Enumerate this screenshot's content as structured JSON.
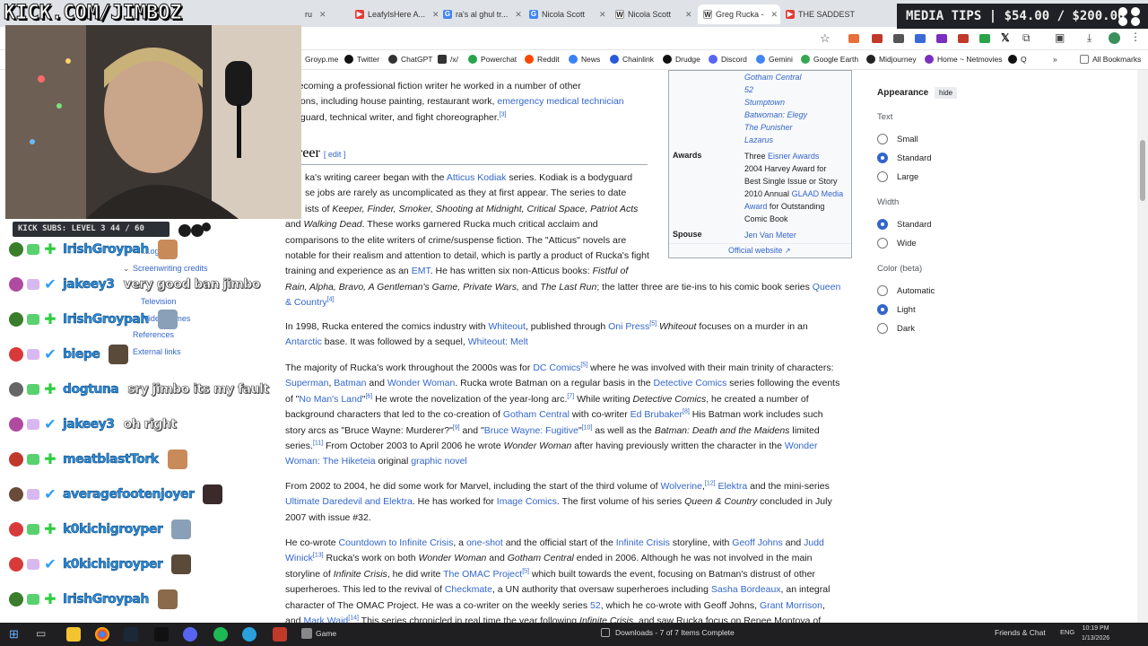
{
  "overlay": {
    "channel": "KICK.COM/JIMBOZ",
    "media_tips": "MEDIA TIPS | $54.00 / $200.00",
    "kick_subs": "KICK SUBS: LEVEL 3  44 / 60"
  },
  "tabs": [
    {
      "label": "ru",
      "color": "#e5a32b"
    },
    {
      "label": "LeafyIsHere A...",
      "color": "#e53935"
    },
    {
      "label": "ra's al ghul tr...",
      "color": "#4285f4"
    },
    {
      "label": "Nicola Scott",
      "color": "#4285f4"
    },
    {
      "label": "Nicola Scott",
      "color": "#222222"
    },
    {
      "label": "Greg Rucka -",
      "color": "#222222"
    },
    {
      "label": "THE SADDEST",
      "color": "#e53935"
    }
  ],
  "bookmarks": [
    {
      "label": "Groyp.me",
      "color": "#c0392b"
    },
    {
      "label": "Twitter",
      "color": "#111111"
    },
    {
      "label": "ChatGPT",
      "color": "#333333"
    },
    {
      "label": "/x/",
      "color": "#333333"
    },
    {
      "label": "Powerchat",
      "color": "#2aa34a"
    },
    {
      "label": "Reddit",
      "color": "#ff4500"
    },
    {
      "label": "News",
      "color": "#3b82f6"
    },
    {
      "label": "Chainlink",
      "color": "#2a5ada"
    },
    {
      "label": "Drudge",
      "color": "#111111"
    },
    {
      "label": "Discord",
      "color": "#5865f2"
    },
    {
      "label": "Gemini",
      "color": "#4285f4"
    },
    {
      "label": "Google Earth",
      "color": "#34a853"
    },
    {
      "label": "Midjourney",
      "color": "#222222"
    },
    {
      "label": "Home ~ Netmovies",
      "color": "#7b2fbe"
    },
    {
      "label": "Q",
      "color": "#111111"
    },
    {
      "label": "All Bookmarks",
      "color": "#555555"
    }
  ],
  "toc": [
    {
      "label": "...ogr"
    },
    {
      "label": "Screenwriting credits"
    },
    {
      "label": "Television"
    },
    {
      "label": "Video games"
    },
    {
      "label": "References"
    },
    {
      "label": "External links"
    }
  ],
  "chat": [
    {
      "user": "IrishGroypah",
      "msg": "",
      "badge": "#3a7d2a"
    },
    {
      "user": "jakeey3",
      "msg": "very good ban jimbo",
      "badge": "#b04aa0"
    },
    {
      "user": "IrishGroypah",
      "msg": "",
      "badge": "#3a7d2a"
    },
    {
      "user": "biepe",
      "msg": "",
      "badge": "#d83a3a"
    },
    {
      "user": "dogtuna",
      "msg": "sry jimbo its my fault",
      "badge": "#666666"
    },
    {
      "user": "jakeey3",
      "msg": "oh right",
      "badge": "#b04aa0"
    },
    {
      "user": "meatblastTork",
      "msg": "",
      "badge": "#c0392b"
    },
    {
      "user": "averagefootenjoyer",
      "msg": "",
      "badge": "#6a4a3a"
    },
    {
      "user": "k0kichigroyper",
      "msg": "",
      "badge": "#d83a3a"
    },
    {
      "user": "k0kichigroyper",
      "msg": "",
      "badge": "#d83a3a"
    },
    {
      "user": "IrishGroypah",
      "msg": "",
      "badge": "#3a7d2a"
    }
  ],
  "article": {
    "p1": "e becoming a professional fiction writer he worked in a number of other",
    "p1b": "pations, including house painting, restaurant work,",
    "p1b_link": "emergency medical technician",
    "p1c": "rity guard, technical writer, and fight choreographer.",
    "p1c_sup": "[3]",
    "h_career": "reer",
    "edit": "[ edit ]",
    "c1": "ka's writing career began with the",
    "c1_link": "Atticus Kodiak",
    "c1b": "series. Kodiak is a bodyguard",
    "c2": "se jobs are rarely as uncomplicated as they at first appear. The series to date",
    "c3": "ists of",
    "c3_titles": "Keeper, Finder, Smoker, Shooting at Midnight, Critical Space, Patriot Acts",
    "c4_title": "Walking Dead",
    "c4": ". These works garnered Rucka much critical acclaim and",
    "c4a": "and",
    "c5": "comparisons to the elite writers of crime/suspense fiction. The \"Atticus\" novels are",
    "c6": "notable for their realism and attention to detail, which is partly a product of Rucka's fight",
    "c7a": "training and experience as an",
    "c7_link": "EMT",
    "c7b": ". He has written six non-Atticus books:",
    "c7_title": "Fistful of",
    "c8_titles": "Rain, Alpha, Bravo, A Gentleman's Game, Private Wars,",
    "c8a": "and",
    "c8_title2": "The Last Run",
    "c8b": "; the latter three are tie-ins to his comic book series",
    "c8_link": "Queen",
    "c9_link": "& Country",
    "c9_sup": "[4]",
    "w1a": "In 1998, Rucka entered the comics industry with",
    "w1_link": "Whiteout",
    "w1b": ", published through",
    "w1_link2": "Oni Press",
    "w1_sup": "[5]",
    "w1_title": "Whiteout",
    "w1c": "focuses on a murder in an",
    "w2_link": "Antarctic",
    "w2a": "base. It was followed by a sequel,",
    "w2_link2": "Whiteout: Melt",
    "d1a": "The majority of Rucka's work throughout the 2000s was for",
    "d1_link": "DC Comics",
    "d1_sup": "[5]",
    "d1b": "where he was involved with their main trinity of characters:",
    "d2_link1": "Superman",
    "d2_link2": "Batman",
    "d2_and": "and",
    "d2_link3": "Wonder Woman",
    "d2a": ". Rucka wrote Batman on a regular basis in the",
    "d2_link4": "Detective Comics",
    "d2b": "series following the events",
    "d3a": "of \"",
    "d3_link": "No Man's Land",
    "d3_sup": "[6]",
    "d3b": "He wrote the novelization of the year-long arc.",
    "d3_sup2": "[7]",
    "d3c": "While writing",
    "d3_title": "Detective Comics",
    "d3d": ", he created a number of",
    "d4a": "background characters that led to the co-creation of",
    "d4_link": "Gotham Central",
    "d4b": "with co-writer",
    "d4_link2": "Ed Brubaker",
    "d4_sup": "[8]",
    "d4c": "His Batman work includes such",
    "d5a": "story arcs as \"Bruce Wayne: Murderer?\"",
    "d5_sup": "[9]",
    "d5b": "and \"",
    "d5_link": "Bruce Wayne: Fugitive",
    "d5_sup2": "[10]",
    "d5c": "as well as the",
    "d5_title": "Batman: Death and the Maidens",
    "d5d": "limited",
    "d6a": "series.",
    "d6_sup": "[11]",
    "d6b": "From October 2003 to April 2006 he wrote",
    "d6_title": "Wonder Woman",
    "d6c": "after having previously written the character in the",
    "d6_link": "Wonder",
    "d7_link": "Woman: The Hiketeia",
    "d7a": "original",
    "d7_link2": "graphic novel",
    "m1a": "From 2002 to 2004, he did some work for Marvel, including the start of the third volume of",
    "m1_link": "Wolverine",
    "m1_sup": "[12]",
    "m1_link2": "Elektra",
    "m1b": "and the mini-series",
    "m2_link": "Ultimate Daredevil and Elektra",
    "m2a": ". He has worked for",
    "m2_link2": "Image Comics",
    "m2b": ". The first volume of his series",
    "m2_title": "Queen & Country",
    "m2c": "concluded in July",
    "m3": "2007 with issue #32.",
    "o1a": "He co-wrote",
    "o1_link": "Countdown to Infinite Crisis",
    "o1b": ", a",
    "o1_link2": "one-shot",
    "o1c": "and the official start of the",
    "o1_link3": "Infinite Crisis",
    "o1d": "storyline, with",
    "o1_link4": "Geoff Johns",
    "o1e": "and",
    "o1_link5": "Judd",
    "o2_link": "Winick",
    "o2_sup": "[13]",
    "o2a": "Rucka's work on both",
    "o2_title": "Wonder Woman",
    "o2b": "and",
    "o2_title2": "Gotham Central",
    "o2c": "ended in 2006. Although he was not involved in the main",
    "o3a": "storyline of",
    "o3_title": "Infinite Crisis",
    "o3b": ", he did write",
    "o3_link": "The OMAC Project",
    "o3_sup": "[5]",
    "o3c": "which built towards the event, focusing on Batman's distrust of other",
    "o4a": "superheroes. This led to the revival of",
    "o4_link": "Checkmate",
    "o4b": ", a UN authority that oversaw superheroes including",
    "o4_link2": "Sasha Bordeaux",
    "o4c": ", an integral",
    "o5a": "character of The OMAC Project. He was a co-writer on the weekly series",
    "o5_link": "52",
    "o5b": ", which he co-wrote with Geoff Johns,",
    "o5_link2": "Grant Morrison",
    "o5c": ",",
    "o6a": "and",
    "o6_link": "Mark Waid",
    "o6_sup": "[14]",
    "o6b": "This series chronicled in real time the year following",
    "o6_title": "Infinite Crisis",
    "o6c": ", and saw Rucka focus on Renee Montoya of"
  },
  "infobox": {
    "works": [
      "Gotham Central",
      "52",
      "Stumptown",
      "Batwoman: Elegy",
      "The Punisher",
      "Lazarus"
    ],
    "awards_label": "Awards",
    "awards_a": "Three",
    "awards_link": "Eisner Awards",
    "awards_b": "2004 Harvey Award for",
    "awards_c": "Best Single Issue or Story",
    "awards_d": "2010 Annual",
    "awards_link2": "GLAAD Media",
    "awards_link3": "Award",
    "awards_e": "for Outstanding",
    "awards_f": "Comic Book",
    "spouse_label": "Spouse",
    "spouse": "Jen Van Meter",
    "website": "Official website"
  },
  "panel": {
    "title": "Appearance",
    "hide": "hide",
    "text_label": "Text",
    "text_options": [
      "Small",
      "Standard",
      "Large"
    ],
    "text_selected": "Standard",
    "width_label": "Width",
    "width_options": [
      "Standard",
      "Wide"
    ],
    "width_selected": "Standard",
    "color_label": "Color (beta)",
    "color_options": [
      "Automatic",
      "Light",
      "Dark"
    ],
    "color_selected": "Light"
  },
  "taskbar": {
    "game": "Game",
    "downloads": "Downloads - 7 of 7 Items Complete",
    "friends": "Friends & Chat",
    "lang": "ENG",
    "time": "10:19 PM",
    "date": "1/13/2026"
  },
  "colors": {
    "link": "#3366cc",
    "accent": "#3366cc",
    "chat_name": "#2a8fe0"
  }
}
